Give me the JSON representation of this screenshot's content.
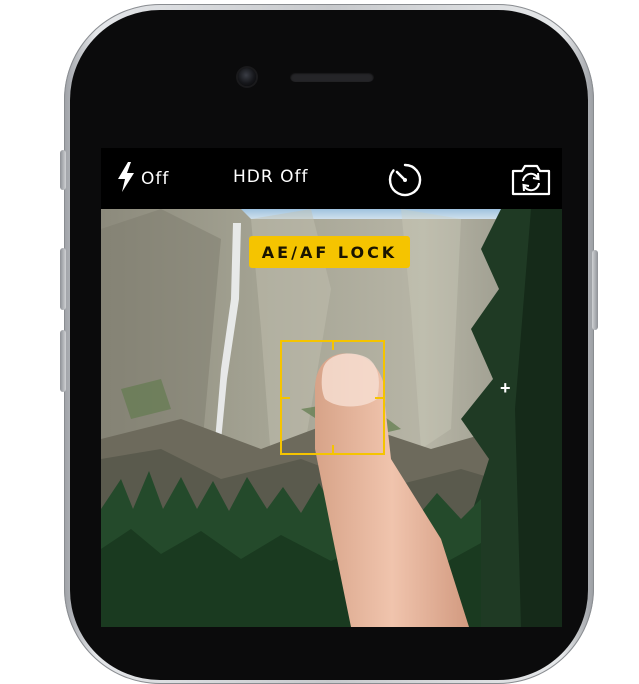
{
  "camera_topbar": {
    "flash_label": "Off",
    "hdr_label": "HDR Off",
    "flash_icon": "lightning-bolt-icon",
    "timer_icon": "timer-icon",
    "flip_icon": "camera-flip-icon"
  },
  "viewfinder": {
    "lock_badge": "AE/AF LOCK",
    "focus_marker": "focus-square",
    "crosshair_icon": "plus-icon"
  },
  "colors": {
    "accent_yellow": "#f5c400",
    "bar_background": "#000000"
  }
}
